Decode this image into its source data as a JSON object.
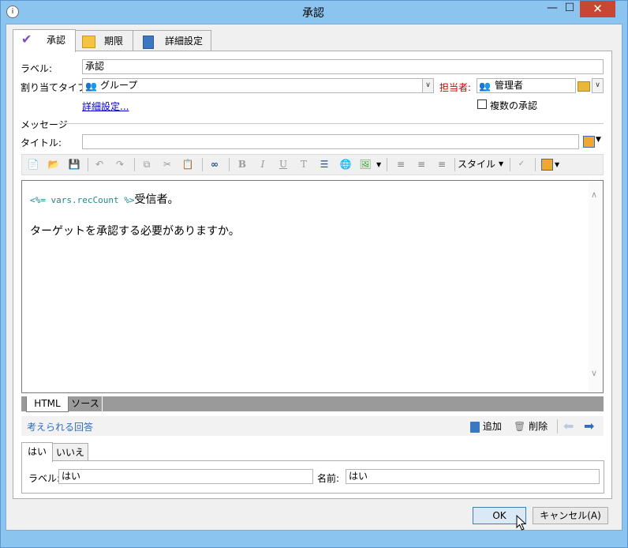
{
  "window": {
    "title": "承認",
    "minimize": "—",
    "maximize": "☐",
    "close": "✕"
  },
  "tabs": [
    {
      "label": "承認",
      "icon": "checkmark-icon"
    },
    {
      "label": "期限",
      "icon": "calendar-icon"
    },
    {
      "label": "詳細設定",
      "icon": "clipboard-icon"
    }
  ],
  "form": {
    "label_caption": "ラベル:",
    "label_value": "承認",
    "assign_type_caption": "割り当てタイプ:",
    "assign_type_value": "グループ",
    "assignee_caption": "担当者:",
    "assignee_value": "管理者",
    "advanced_link": "詳細設定...",
    "multiple_approval": "複数の承認",
    "multiple_approval_checked": false
  },
  "message": {
    "section_caption": "メッセージ",
    "title_caption": "タイトル:",
    "title_value": ""
  },
  "toolbar": {
    "style_label": "スタイル"
  },
  "editor": {
    "code_snippet": "<%= vars.recCount %>",
    "line1_suffix": "受信者。",
    "line2": "ターゲットを承認する必要がありますか。"
  },
  "modes": [
    "HTML",
    "ソース"
  ],
  "answers": {
    "caption": "考えられる回答",
    "add_label": "追加",
    "delete_label": "削除",
    "tabs": [
      "はい",
      "いいえ"
    ],
    "label_caption": "ラベル:",
    "label_value": "はい",
    "name_caption": "名前:",
    "name_value": "はい"
  },
  "buttons": {
    "ok": "OK",
    "cancel": "キャンセル(A)"
  },
  "colors": {
    "titlebar": "#8cc4f0",
    "close": "#c74634",
    "assignee_caption": "#cc0000",
    "link": "#0000cc",
    "code": "#1e8a8a"
  }
}
